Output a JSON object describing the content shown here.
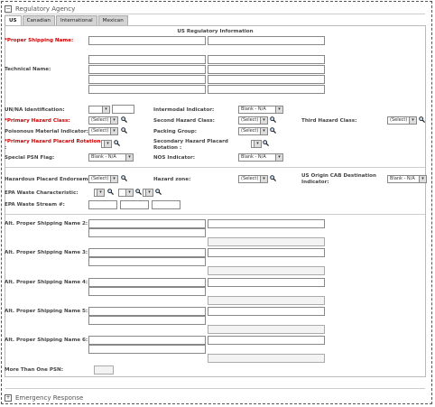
{
  "section": {
    "title": "Regulatory Agency",
    "toggle": "−"
  },
  "tabs": [
    "US",
    "Canadian",
    "International",
    "Mexican"
  ],
  "panel_title": "US Regulatory Information",
  "labels": {
    "proper_shipping_name": "*Proper Shipping Name:",
    "technical_name": "Technical Name:",
    "un_na": "UN/NA Identification:",
    "intermodal": "Intermodal Indicator:",
    "primary_hazard_class": "*Primary Hazard Class:",
    "second_hazard_class": "Second Hazard Class:",
    "third_hazard_class": "Third Hazard Class:",
    "poisonous_material": "Poisonous Material Indicator:",
    "packing_group": "Packing Group:",
    "placard_rotation": "*Primary Hazard Placard Rotation",
    "placard_rotation_colon": ":",
    "secondary_placard_rotation": "Secondary Hazard Placard",
    "secondary_placard_rotation_2": "Rotation :",
    "special_psn": "Special PSN Flag:",
    "nos": "NOS Indicator:",
    "hazardous_placard": "Hazardous Placard Endorsement:",
    "hazard_zone": "Hazard zone:",
    "us_origin_cab": "US Origin CAB Destination",
    "us_origin_cab_2": "Indicator:",
    "epa_waste_char": "EPA Waste Characteristic:",
    "epa_waste_stream": "EPA Waste Stream #:",
    "alt2": "Alt. Proper Shipping Name 2:",
    "alt3": "Alt. Proper Shipping Name 3:",
    "alt4": "Alt. Proper Shipping Name 4:",
    "alt5": "Alt. Proper Shipping Name 5:",
    "alt6": "Alt. Proper Shipping Name 6:",
    "more_than_one_psn": "More Than One PSN:"
  },
  "selects": {
    "select": "(Select)",
    "blank_na": "Blank - N/A",
    "arrow": "▾"
  },
  "footer": {
    "title": "Emergency Response",
    "toggle": "+"
  }
}
